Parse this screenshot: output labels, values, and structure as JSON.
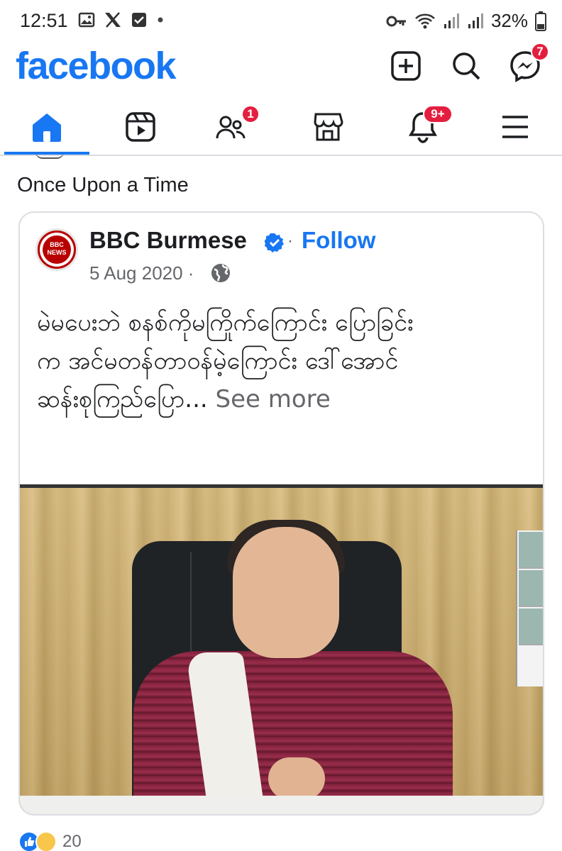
{
  "status_bar": {
    "time": "12:51",
    "battery": "32%",
    "left_icons": [
      "gallery-icon",
      "x-icon",
      "checkbox-icon",
      "dot-icon"
    ],
    "right_icons": [
      "key-icon",
      "wifi-icon",
      "signal-icon",
      "signal-icon",
      "battery-icon"
    ]
  },
  "header": {
    "logo": "facebook",
    "create_icon": "plus-square-icon",
    "search_icon": "search-icon",
    "messenger_icon": "messenger-icon",
    "messenger_badge": "7"
  },
  "tabs": [
    {
      "name": "home",
      "icon": "home-icon",
      "active": true,
      "badge": ""
    },
    {
      "name": "video",
      "icon": "video-icon",
      "active": false,
      "badge": ""
    },
    {
      "name": "friends",
      "icon": "friends-icon",
      "active": false,
      "badge": "1"
    },
    {
      "name": "marketplace",
      "icon": "marketplace-icon",
      "active": false,
      "badge": ""
    },
    {
      "name": "notifications",
      "icon": "bell-icon",
      "active": false,
      "badge": "9+"
    },
    {
      "name": "menu",
      "icon": "menu-icon",
      "active": false,
      "badge": ""
    }
  ],
  "feed": {
    "group_title": "Once Upon a Time",
    "post": {
      "page_name": "BBC Burmese",
      "avatar_text": "BBC NEWS",
      "follow_label": "Follow",
      "separator": "·",
      "date": "5 Aug 2020 ·",
      "text_line1": "မဲမပေးဘဲ စနစ်ကိုမကြိုက်ကြောင်း ပြောခြင်း",
      "text_line2": "က အင်မတန်တာဝန်မဲ့ကြောင်း ဒေါ်အောင်",
      "text_line3": "ဆန်းစုကြည်ပြော...",
      "see_more": "See more"
    },
    "reactions": {
      "count": "20",
      "icons": [
        "like-icon",
        "haha-icon"
      ]
    }
  },
  "colors": {
    "brand": "#1877f2",
    "badge": "#e41e3f",
    "secondary_text": "#65676b"
  }
}
